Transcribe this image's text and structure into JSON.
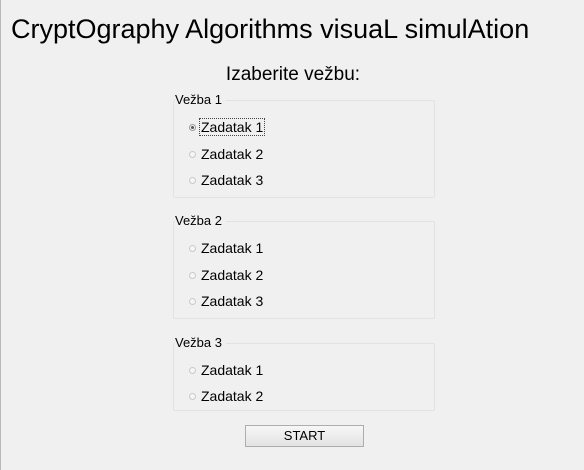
{
  "window": {
    "title": "CryptOgraphy Algorithms visuaL simulAtion",
    "prompt": "Izaberite vežbu:"
  },
  "groups": [
    {
      "label": "Vežba 1",
      "options": [
        "Zadatak 1",
        "Zadatak 2",
        "Zadatak 3"
      ],
      "selected": 0
    },
    {
      "label": "Vežba 2",
      "options": [
        "Zadatak 1",
        "Zadatak 2",
        "Zadatak 3"
      ],
      "selected": null
    },
    {
      "label": "Vežba 3",
      "options": [
        "Zadatak 1",
        "Zadatak 2"
      ],
      "selected": null
    }
  ],
  "start_button": {
    "label": "START"
  }
}
